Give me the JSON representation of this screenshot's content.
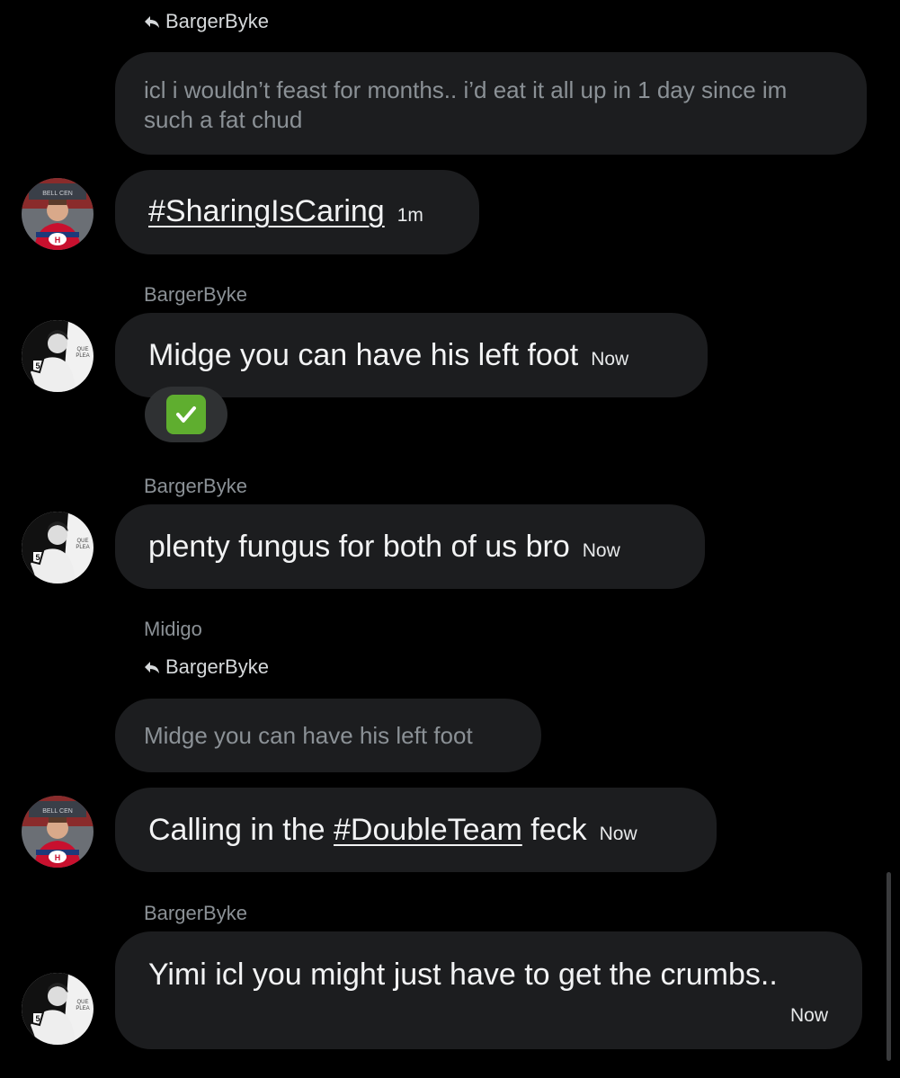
{
  "messages": [
    {
      "reply_to": "BargerByke",
      "quoted_text": "icl i wouldn’t feast for months.. i’d eat it all up in 1 day since im such a fat chud"
    },
    {
      "hashtag": "#SharingIsCaring",
      "time": "1m",
      "avatar": "red-jersey-avatar"
    },
    {
      "sender": "BargerByke",
      "text": "Midge you can have his left foot",
      "time": "Now",
      "avatar": "bw-avatar",
      "reaction": "✅"
    },
    {
      "sender": "BargerByke",
      "text": "plenty fungus for both of us bro",
      "time": "Now",
      "avatar": "bw-avatar"
    },
    {
      "sender": "Midigo",
      "reply_to": "BargerByke",
      "quoted_text": "Midge you can have his left foot"
    },
    {
      "text_before": "Calling in the ",
      "hashtag": "#DoubleTeam",
      "text_after": " feck",
      "time": "Now",
      "avatar": "red-jersey-avatar"
    },
    {
      "sender": "BargerByke",
      "text": "Yimi icl you might just have to get the crumbs..",
      "time": "Now",
      "avatar": "bw-avatar"
    }
  ],
  "colors": {
    "background": "#000000",
    "bubble": "#1c1d1f",
    "reaction_bg": "#2f3133",
    "check_green": "#5fae2f",
    "jersey_red": "#c8102e"
  }
}
